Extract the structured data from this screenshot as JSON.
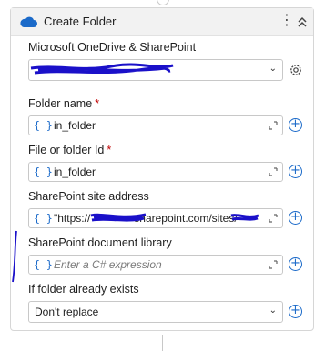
{
  "activity": {
    "title": "Create Folder",
    "icons": {
      "brand": "onedrive-cloud-icon",
      "menu": "kebab-menu-icon",
      "collapse": "collapse-chevrons-icon"
    }
  },
  "connection": {
    "label": "Microsoft OneDrive & SharePoint"
  },
  "fields": {
    "folder_name": {
      "label": "Folder name",
      "required": "*",
      "value": "in_folder"
    },
    "file_or_folder_id": {
      "label": "File or folder Id",
      "required": "*",
      "value": "in_folder"
    },
    "site_address": {
      "label": "SharePoint site address",
      "value": "\"https://    sharepoint.com/sites/"
    },
    "document_library": {
      "label": "SharePoint document library",
      "placeholder": "Enter a C# expression"
    }
  },
  "if_exists": {
    "label": "If folder already exists",
    "selected": "Don't replace"
  },
  "symbols": {
    "brace": "{ }",
    "plus": "+",
    "chevron": "⌄"
  },
  "colors": {
    "accent": "#1b6ac9",
    "redaction": "#1a10c9",
    "required": "#c00000"
  }
}
